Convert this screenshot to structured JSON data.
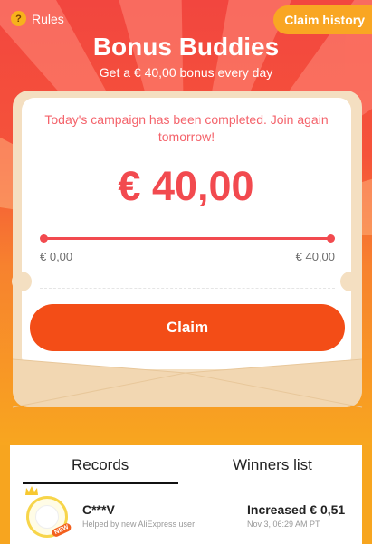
{
  "header": {
    "rules_label": "Rules",
    "rules_icon": "question-icon",
    "claim_history_label": "Claim history",
    "title": "Bonus Buddies",
    "subtitle": "Get a € 40,00 bonus every day"
  },
  "card": {
    "notice": "Today's campaign has been completed. Join again tomorrow!",
    "amount": "€ 40,00",
    "progress_fraction": 1.0,
    "min_label": "€ 0,00",
    "max_label": "€ 40,00",
    "claim_label": "Claim"
  },
  "tabs": {
    "records": "Records",
    "winners": "Winners list"
  },
  "records": [
    {
      "name": "C***V",
      "description": "Helped by new AliExpress user",
      "badge": "NEW",
      "amount": "Increased € 0,51",
      "time": "Nov 3, 06:29 AM PT"
    }
  ],
  "colors": {
    "accent_red": "#f24a4f",
    "button_orange": "#f34d17",
    "background_orange": "#f7a51f"
  }
}
